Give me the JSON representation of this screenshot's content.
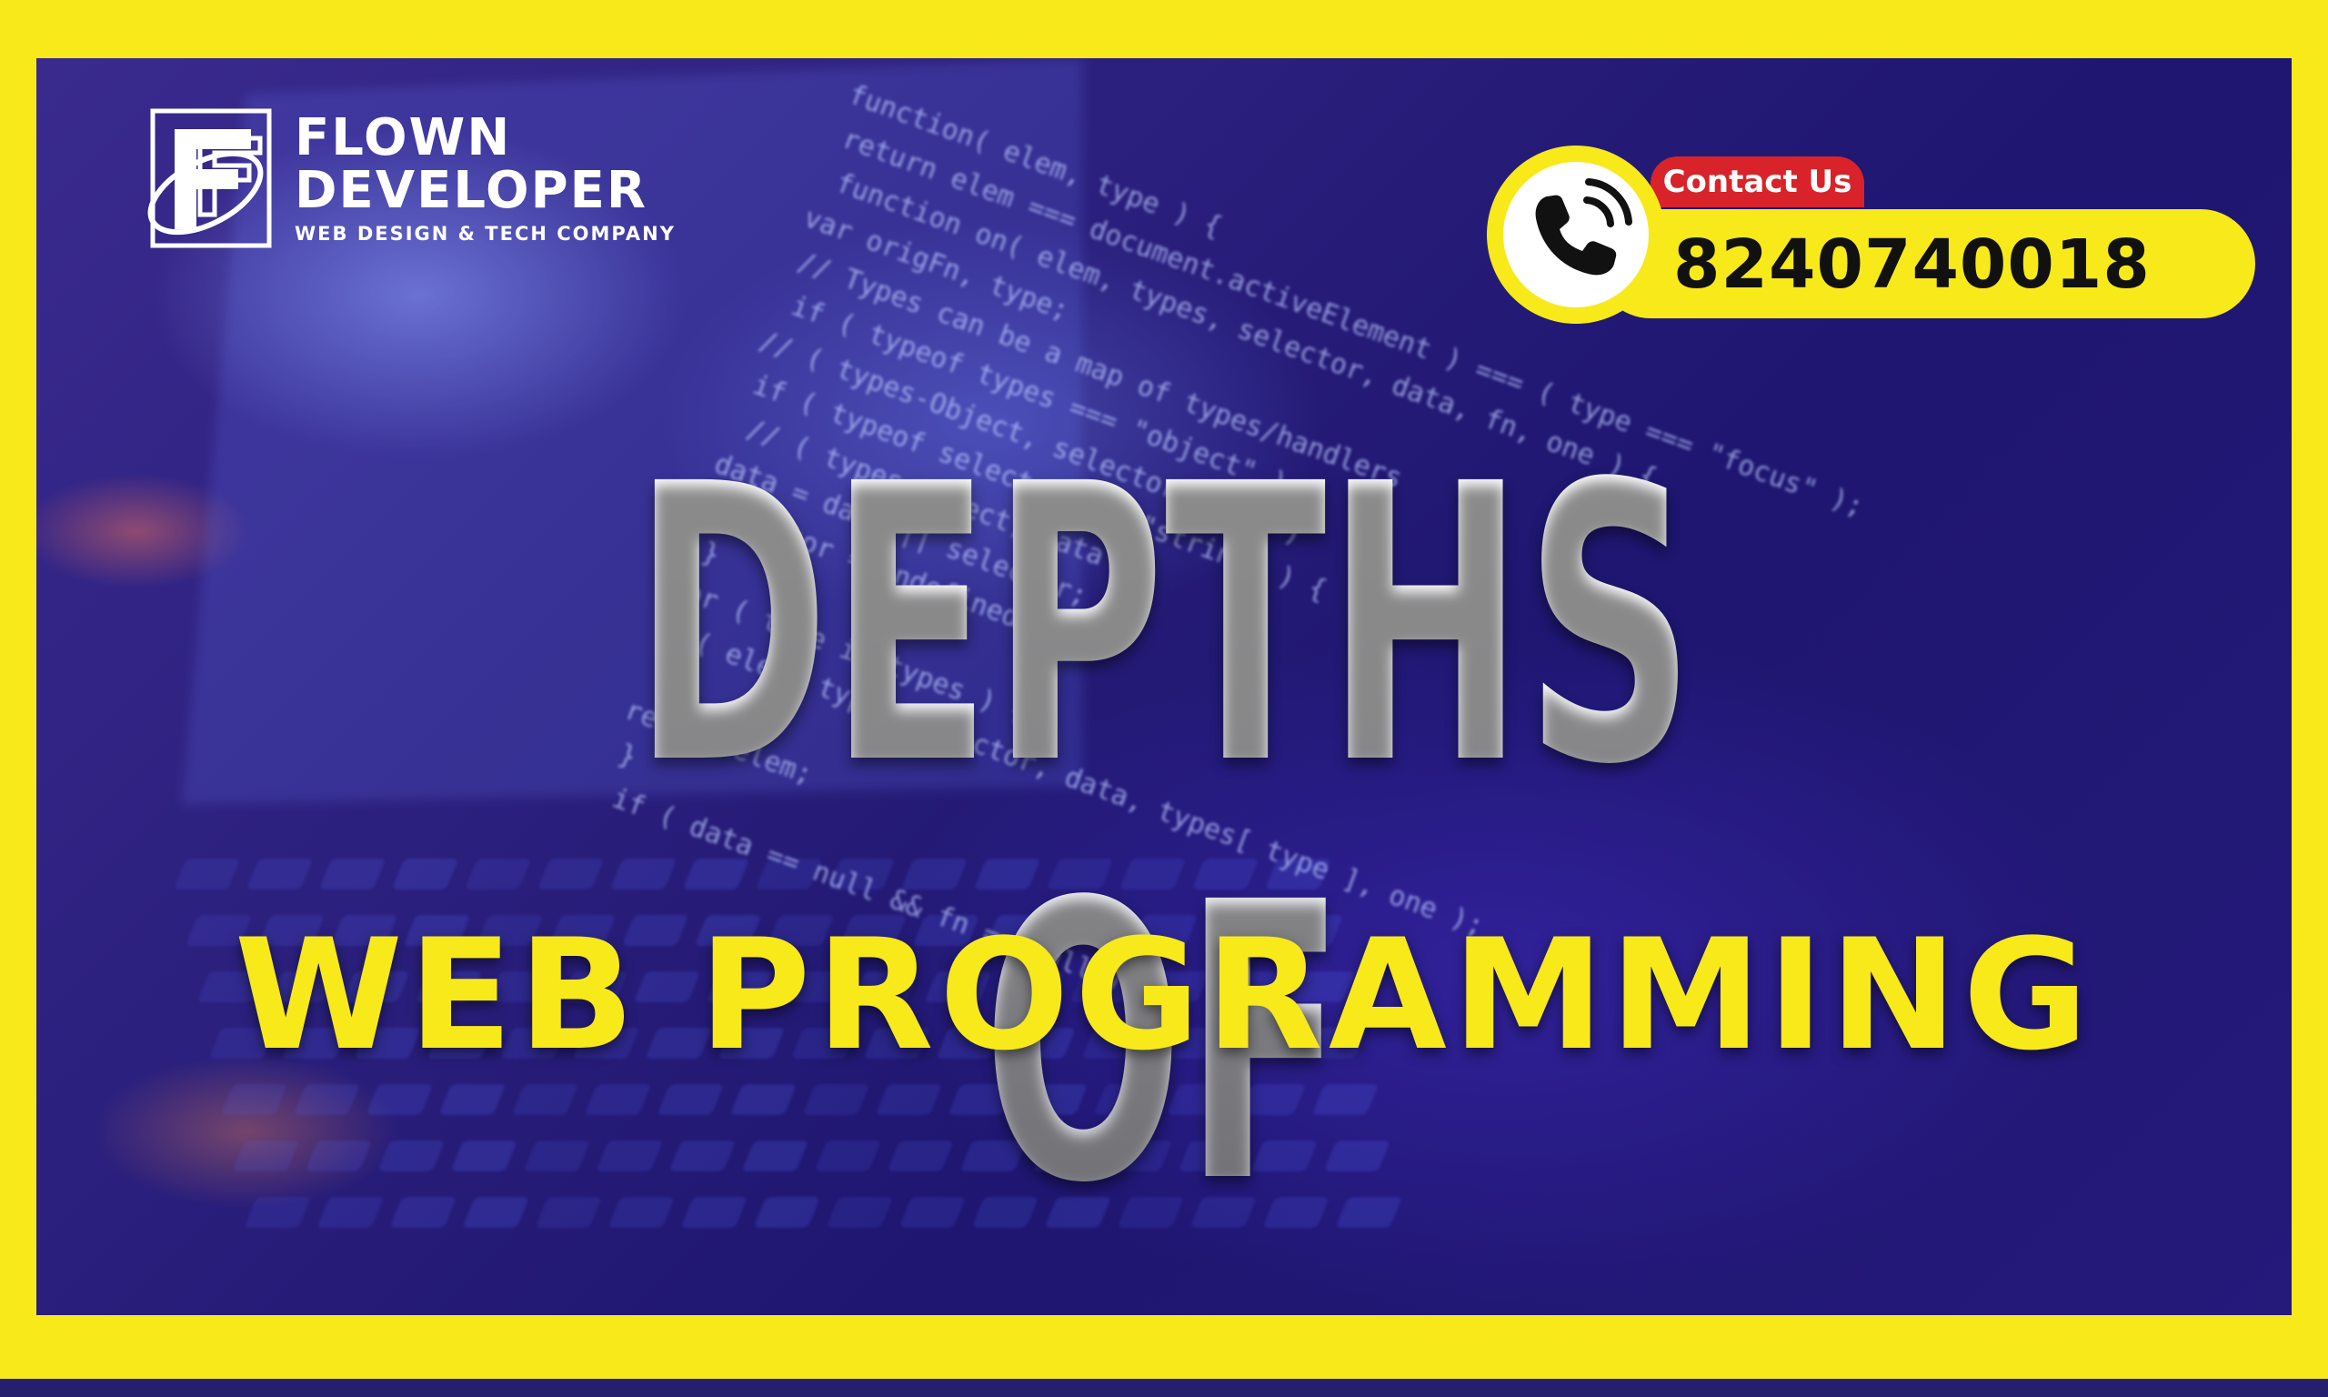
{
  "brand": {
    "line1": "FLOWN",
    "line2": "DEVELOPER",
    "tagline": "WEB DESIGN & TECH COMPANY"
  },
  "contact": {
    "label": "Contact Us",
    "phone": "8240740018"
  },
  "headline": {
    "main": "DEPTHS OF",
    "sub": "WEB PROGRAMMING"
  },
  "background_code": [
    "function( elem, type ) {",
    "  return elem === document.activeElement ) === ( type === \"focus\" );",
    "function on( elem, types, selector, data, fn, one ) {",
    "  var origFn, type;",
    "// Types can be a map of types/handlers",
    "if ( typeof types === \"object\" ) {",
    "  // ( types-Object, selector, data )",
    "  if ( typeof selector !== \"string\" ) {",
    "    // ( types-Object, data )",
    "    data = data || selector;",
    "    selector = undefined;",
    "  }",
    "  for ( type in types ) {",
    "    on( elem, type, selector, data, types[ type ], one );",
    "  }",
    "  return elem;",
    "}",
    "if ( data == null && fn == null ) {"
  ],
  "colors": {
    "frame": "#f8e91b",
    "accent_red": "#d8232a",
    "background": "#2a1f7c",
    "headline": "#ffffff",
    "subheadline": "#f8e91b"
  },
  "icons": [
    "logo-mark-icon",
    "phone-icon"
  ]
}
